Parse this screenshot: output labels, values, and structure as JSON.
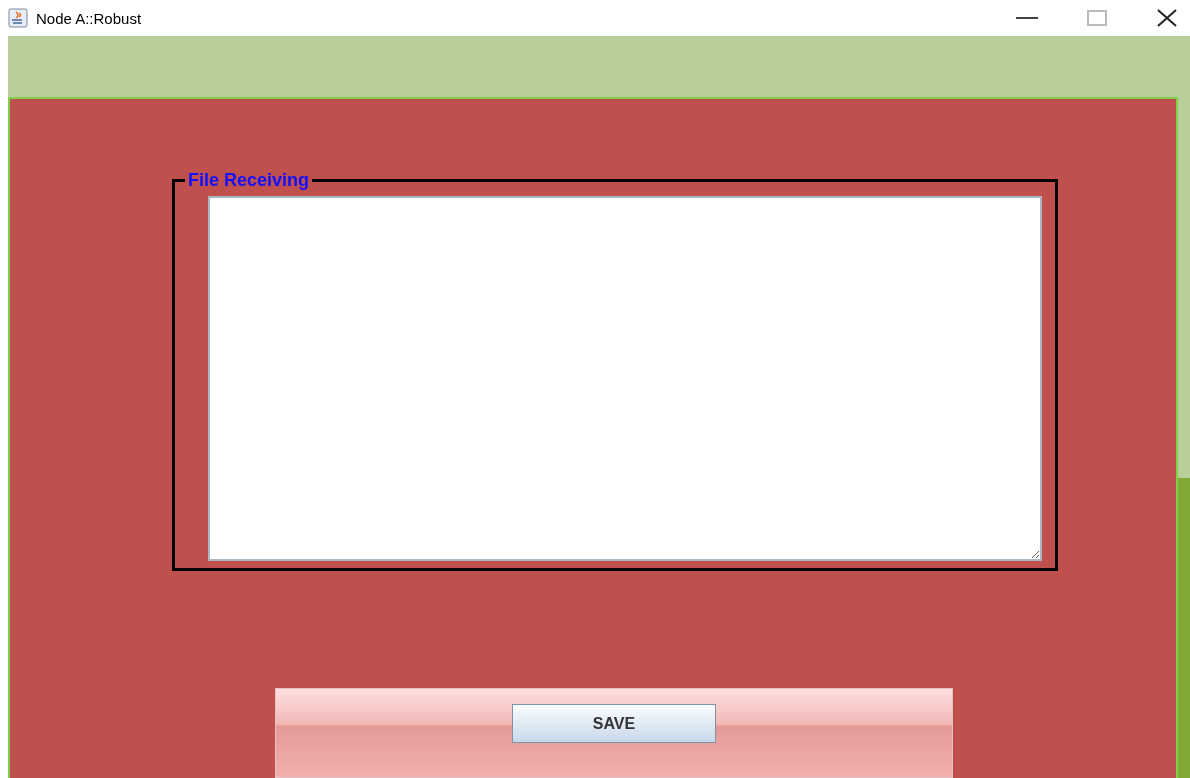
{
  "window": {
    "title": "Node A::Robust"
  },
  "panel": {
    "group_title": "File Receiving"
  },
  "buttons": [
    {
      "label": "SAVE"
    }
  ]
}
